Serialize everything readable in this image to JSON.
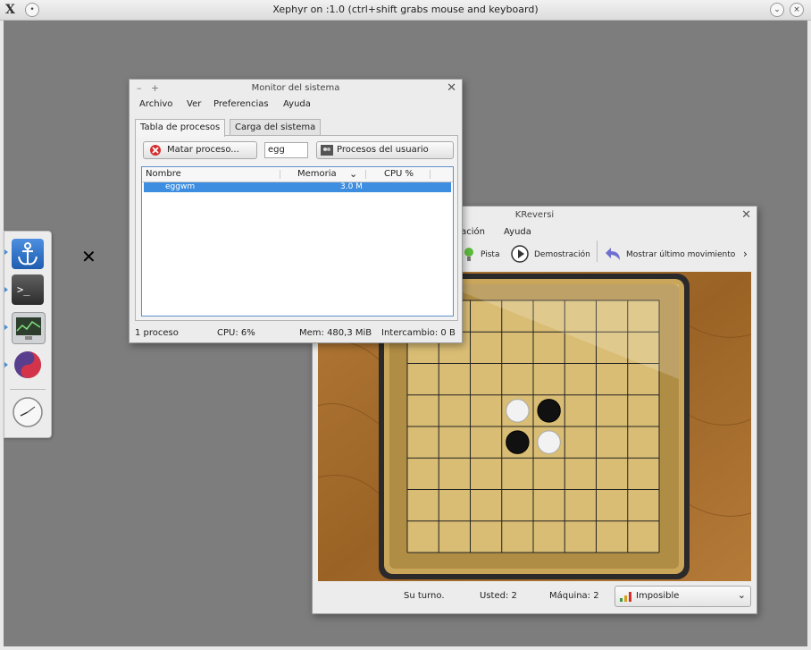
{
  "xephyr": {
    "title": "Xephyr on :1.0 (ctrl+shift grabs mouse and keyboard)"
  },
  "monitor": {
    "title": "Monitor del sistema",
    "window_buttons": {
      "minimize": "–",
      "maximize": "+",
      "close": "✕"
    },
    "menu": [
      "Archivo",
      "Ver",
      "Preferencias",
      "Ayuda"
    ],
    "tabs": [
      "Tabla de procesos",
      "Carga del sistema"
    ],
    "kill_button": "Matar proceso...",
    "filter_value": "egg",
    "filter_combo": "Procesos del usuario",
    "columns": [
      "Nombre",
      "Memoria",
      "CPU %"
    ],
    "rows": [
      {
        "name": "eggwm",
        "memory": "3.0 M",
        "cpu": ""
      }
    ],
    "status": {
      "processes": "1 proceso",
      "cpu": "CPU: 6%",
      "mem": "Mem: 480,3 MiB",
      "swap": "Intercambio: 0 B"
    }
  },
  "kreversi": {
    "title": "KReversi",
    "menu_partial": [
      "ración",
      "Ayuda"
    ],
    "toolbar": {
      "hint": "Pista",
      "demo": "Demostración",
      "last_move": "Mostrar último movimiento",
      "more": "›"
    },
    "status": {
      "turn": "Su turno.",
      "you": "Usted: 2",
      "machine": "Máquina: 2"
    },
    "difficulty": "Imposible",
    "board": {
      "size": 8,
      "pieces": [
        {
          "row": 3,
          "col": 3,
          "color": "white"
        },
        {
          "row": 3,
          "col": 4,
          "color": "black"
        },
        {
          "row": 4,
          "col": 3,
          "color": "black"
        },
        {
          "row": 4,
          "col": 4,
          "color": "white"
        }
      ]
    }
  },
  "colors": {
    "selection": "#3d8ee0",
    "desktop": "#7d7d7d",
    "wood": "#a36d2a",
    "board": "#d9bd74"
  }
}
